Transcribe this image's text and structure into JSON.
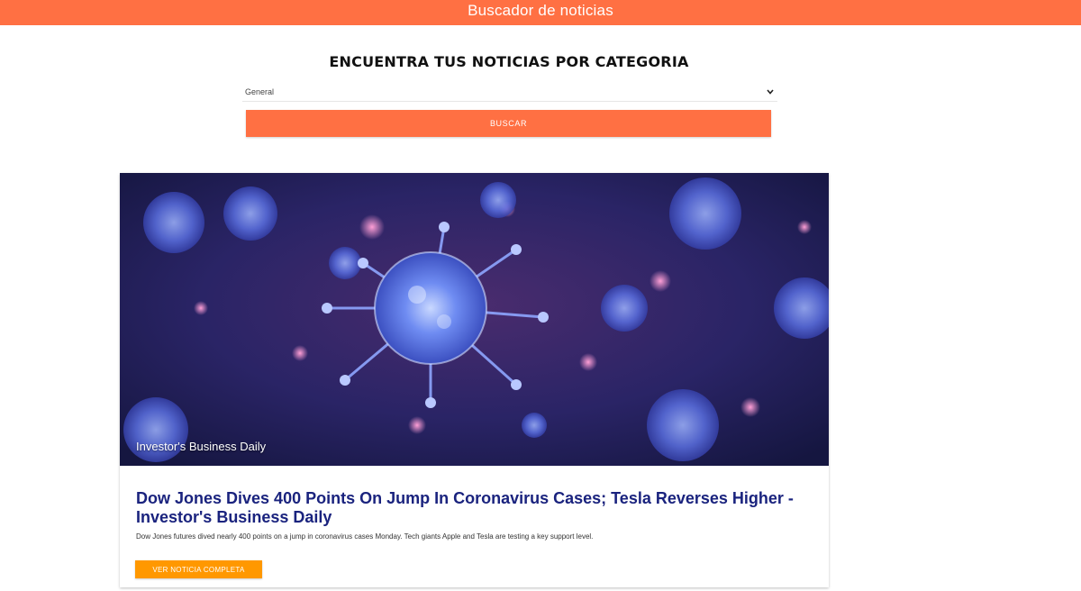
{
  "header": {
    "title": "Buscador de noticias",
    "background_color": "#ff7043"
  },
  "form": {
    "heading": "ENCUENTRA TUS NOTICIAS POR CATEGORIA",
    "category_select": {
      "selected_value": "General",
      "icon": "chevron-down-icon"
    },
    "search_button_label": "BUSCAR",
    "search_button_color": "#ff7043"
  },
  "news": [
    {
      "source": "Investor's Business Daily",
      "title": "Dow Jones Dives 400 Points On Jump In Coronavirus Cases; Tesla Reverses Higher - Investor's Business Daily",
      "description": "Dow Jones futures dived nearly 400 points on a jump in coronavirus cases Monday. Tech giants Apple and Tesla are testing a key support level.",
      "button_label": "VER NOTICIA COMPLETA",
      "button_color": "#ff9800",
      "title_color": "#1a237e"
    }
  ]
}
